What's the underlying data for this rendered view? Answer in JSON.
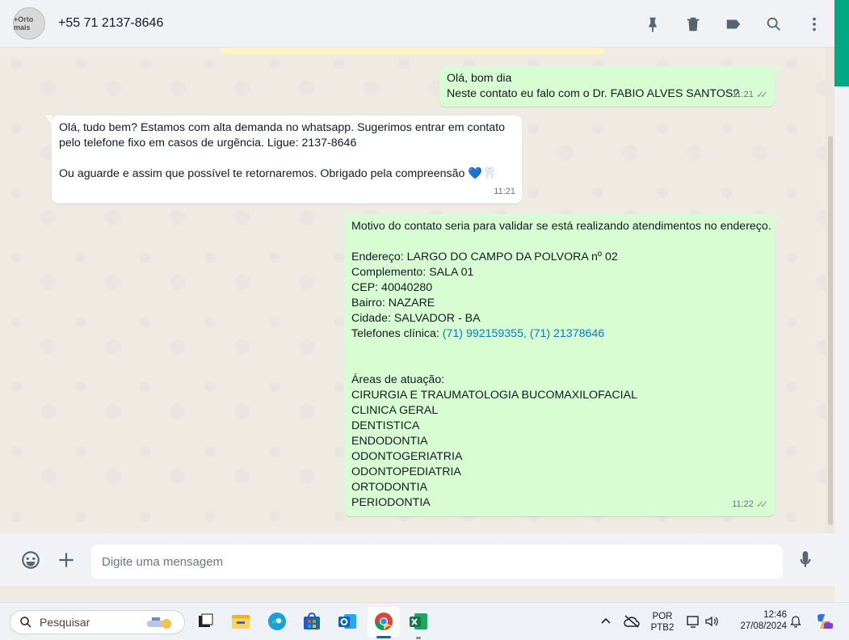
{
  "header": {
    "avatar_text": "+Orto mais",
    "contact": "+55 71 2137-8646"
  },
  "messages": [
    {
      "dir": "out",
      "lines": [
        "Olá, bom dia",
        "Neste contato eu falo com o Dr. FABIO ALVES SANTOS?"
      ],
      "time": "11:21",
      "ticks": "✓✓"
    },
    {
      "dir": "in",
      "lines": [
        "Olá, tudo bem? Estamos com alta demanda no whatsapp. Sugerimos entrar em contato",
        "pelo telefone fixo em casos de urgência. Ligue: 2137-8646",
        "",
        "Ou aguarde e assim que possível te retornaremos. Obrigado pela compreensão"
      ],
      "emoji": "💙🦷",
      "time": "11:21"
    },
    {
      "dir": "out",
      "lines": [
        "Motivo do contato seria para validar se está realizando atendimentos no endereço.",
        "",
        "Endereço: LARGO DO CAMPO DA POLVORA nº 02",
        "Complemento: SALA 01",
        "CEP: 40040280",
        "Bairro: NAZARE",
        "Cidade: SALVADOR - BA"
      ],
      "phones_label": "Telefones clínica: ",
      "phones": "(71) 992159355, (71) 21378646",
      "lines2": [
        "",
        "",
        "Áreas de atuação:",
        "CIRURGIA E TRAUMATOLOGIA BUCOMAXILOFACIAL",
        "CLINICA GERAL",
        "DENTISTICA",
        "ENDODONTIA",
        "ODONTOGERIATRIA",
        "ODONTOPEDIATRIA",
        "ORTODONTIA",
        "PERIODONTIA"
      ],
      "time": "11:22",
      "ticks": "✓✓"
    }
  ],
  "composer": {
    "placeholder": "Digite uma mensagem"
  },
  "taskbar": {
    "search_label": "Pesquisar",
    "lang_top": "POR",
    "lang_bottom": "PTB2",
    "time": "12:46",
    "date": "27/08/2024"
  },
  "icons": [
    "avatar",
    "pin-icon",
    "delete-icon",
    "label-icon",
    "search-icon",
    "menu-icon",
    "emoji-icon",
    "attach-icon",
    "mic-icon"
  ],
  "colors": {
    "outgoing": "#d9fdd3",
    "incoming": "#ffffff",
    "accent": "#00a884",
    "link": "#027eb5"
  }
}
